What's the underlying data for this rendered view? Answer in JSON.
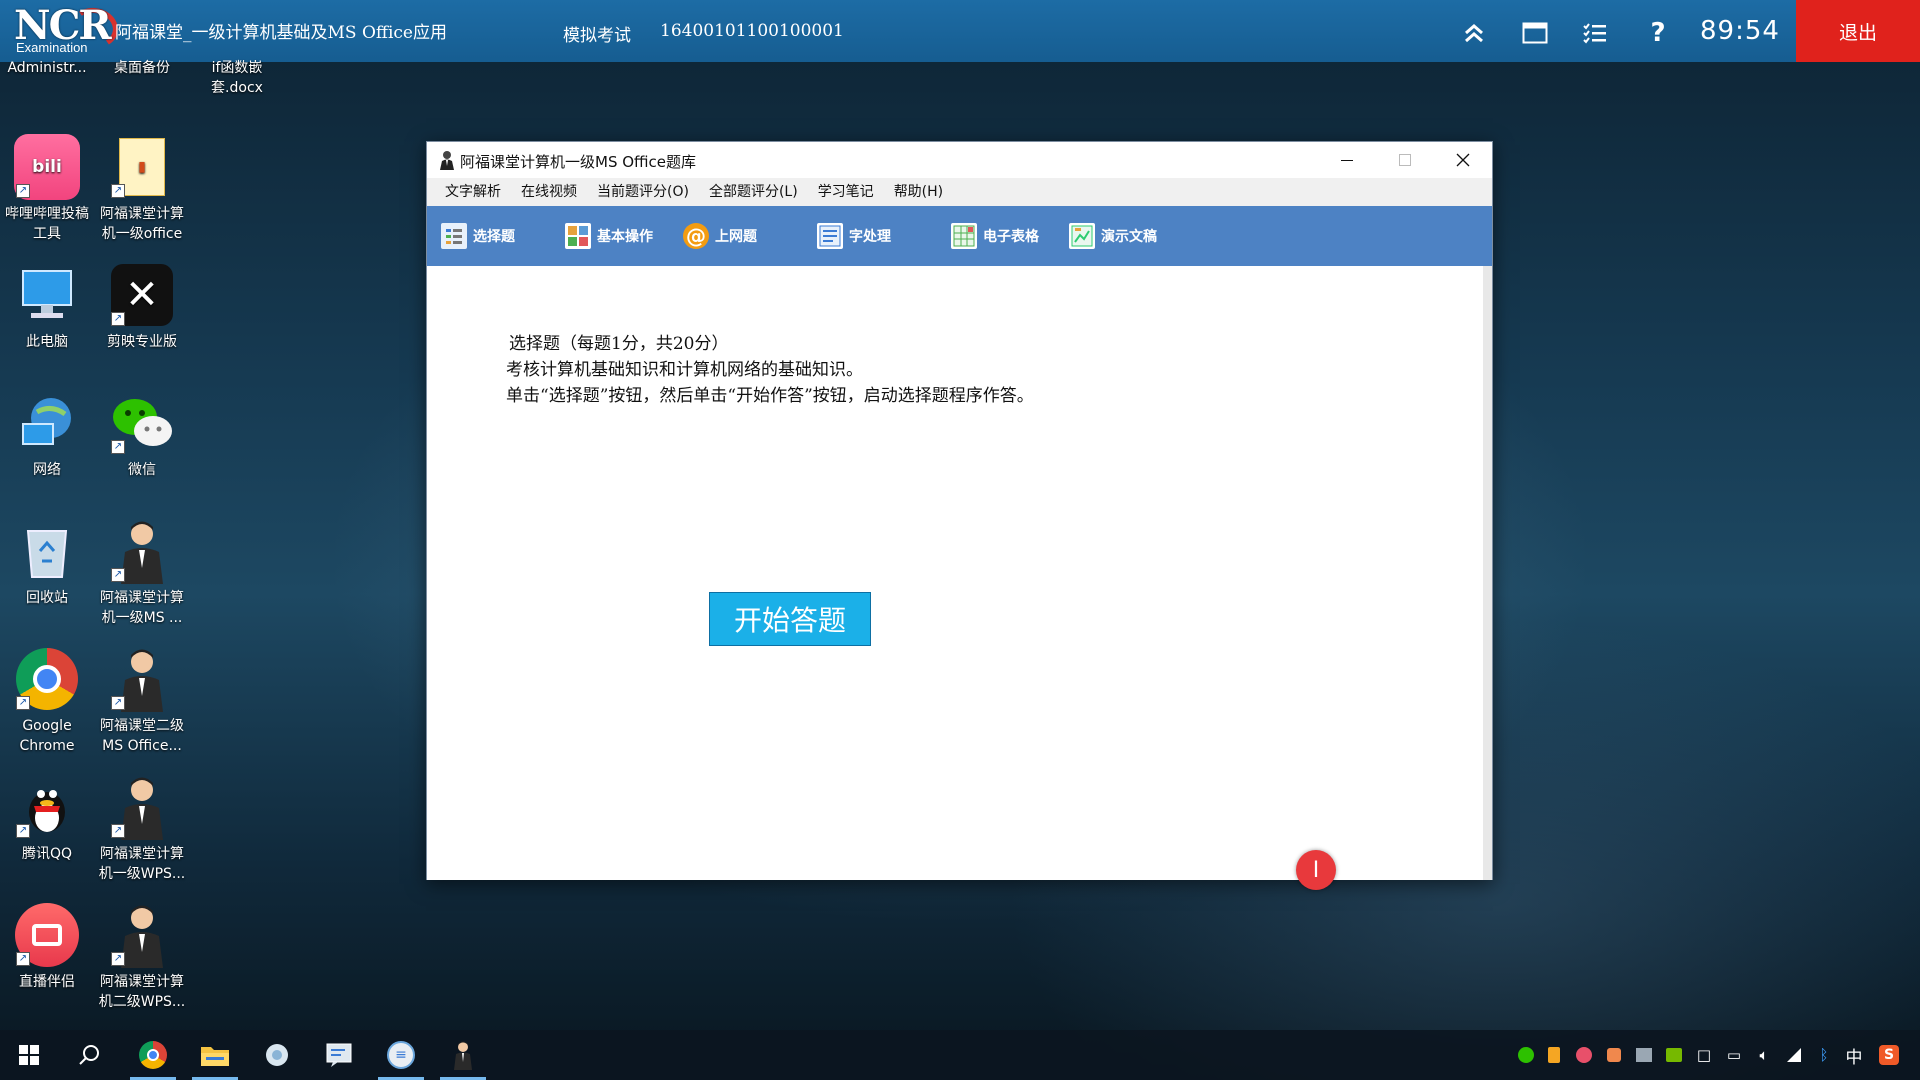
{
  "exam_bar": {
    "logo_text": "NCR",
    "logo_sub": "Examination",
    "course_title": "阿福课堂_一级计算机基础及MS Office应用",
    "mode": "模拟考试",
    "exam_id": "16400101100100001",
    "timer": "89:54",
    "exit_label": "退出",
    "icons": [
      "collapse-up-icon",
      "window-icon",
      "list-icon",
      "help-icon"
    ]
  },
  "desktop": {
    "icons": [
      {
        "label": "Administr...",
        "icon": "user-folder-icon"
      },
      {
        "label": "桌面备份",
        "icon": "folder-icon"
      },
      {
        "label": "if函数嵌套.docx",
        "icon": "word-document-icon"
      },
      {
        "label": "哔哩哔哩投稿工具",
        "icon": "bilibili-icon"
      },
      {
        "label": "阿福课堂计算机一级office",
        "icon": "folder-icon"
      },
      {
        "label": "此电脑",
        "icon": "computer-icon"
      },
      {
        "label": "剪映专业版",
        "icon": "capcut-icon"
      },
      {
        "label": "网络",
        "icon": "network-icon"
      },
      {
        "label": "微信",
        "icon": "wechat-icon"
      },
      {
        "label": "回收站",
        "icon": "recycle-bin-icon"
      },
      {
        "label": "阿福课堂计算机一级MS ...",
        "icon": "teacher-avatar-icon"
      },
      {
        "label": "Google Chrome",
        "icon": "chrome-icon"
      },
      {
        "label": "阿福课堂二级MS Office...",
        "icon": "teacher-avatar-icon"
      },
      {
        "label": "腾讯QQ",
        "icon": "qq-icon"
      },
      {
        "label": "阿福课堂计算机一级WPS...",
        "icon": "teacher-avatar-icon"
      },
      {
        "label": "直播伴侣",
        "icon": "live-companion-icon"
      },
      {
        "label": "阿福课堂计算机二级WPS...",
        "icon": "teacher-avatar-icon"
      }
    ]
  },
  "window": {
    "title": "阿福课堂计算机一级MS Office题库",
    "menu": [
      "文字解析",
      "在线视频",
      "当前题评分(O)",
      "全部题评分(L)",
      "学习笔记",
      "帮助(H)"
    ],
    "toolbar": [
      {
        "label": "选择题",
        "icon": "choice-icon",
        "color": "#5b9bd5"
      },
      {
        "label": "基本操作",
        "icon": "basic-ops-icon",
        "color": "#e6a23c"
      },
      {
        "label": "上网题",
        "icon": "at-sign-icon",
        "color": "#f39c12"
      },
      {
        "label": "字处理",
        "icon": "word-processing-icon",
        "color": "#3a7bd5"
      },
      {
        "label": "电子表格",
        "icon": "spreadsheet-icon",
        "color": "#4caf50"
      },
      {
        "label": "演示文稿",
        "icon": "presentation-icon",
        "color": "#2ecc71"
      }
    ],
    "content": {
      "intro": [
        "选择题（每题1分，共20分）",
        "考核计算机基础知识和计算机网络的基础知识。",
        "单击“选择题”按钮，然后单击“开始作答”按钮，启动选择题程序作答。"
      ],
      "start_button": "开始答题"
    }
  },
  "taskbar": {
    "items": [
      "windows-start-icon",
      "search-icon",
      "chrome-icon",
      "file-explorer-icon",
      "puzzle-app-icon",
      "notes-app-icon",
      "exam-app-icon",
      "teacher-app-icon"
    ],
    "tray": [
      "wechat-tray-icon",
      "audio-tray-icon",
      "app-tray-icon",
      "app-tray-icon-2",
      "monitor-tray-icon",
      "nvidia-tray-icon",
      "display-tray-icon",
      "battery-tray-icon",
      "volume-tray-icon",
      "wifi-tray-icon",
      "bluetooth-tray-icon"
    ],
    "ime": "中",
    "sogou": "S"
  },
  "colors": {
    "exam_bar": "#1d6ca5",
    "exit": "#e0221c",
    "toolbar": "#4d82c4",
    "start_button": "#1bb0e8"
  }
}
